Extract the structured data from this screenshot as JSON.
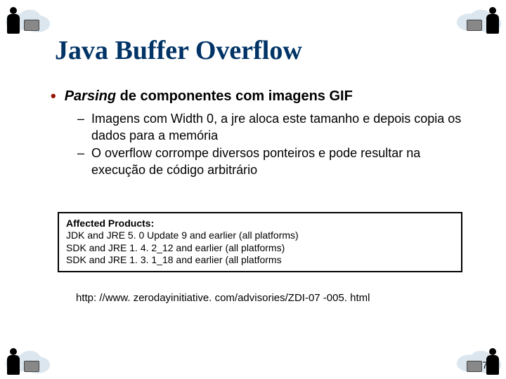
{
  "title": "Java Buffer Overflow",
  "main_bullet_prefix_italic": "Parsing",
  "main_bullet_rest": " de componentes com imagens GIF",
  "sub_bullets": [
    "Imagens com Width 0, a jre aloca este tamanho e depois copia os dados para a memória",
    "O overflow corrompe diversos ponteiros e pode resultar na execução de código arbitrário"
  ],
  "affected": {
    "label": "Affected Products:",
    "lines": [
      "JDK and JRE 5. 0 Update 9 and earlier (all platforms)",
      "SDK and JRE 1. 4. 2_12 and earlier (all platforms)",
      "SDK and JRE 1. 3. 1_18 and earlier (all platforms"
    ]
  },
  "url": "http: //www. zerodayinitiative. com/advisories/ZDI-07 -005. html",
  "page_number": "7"
}
